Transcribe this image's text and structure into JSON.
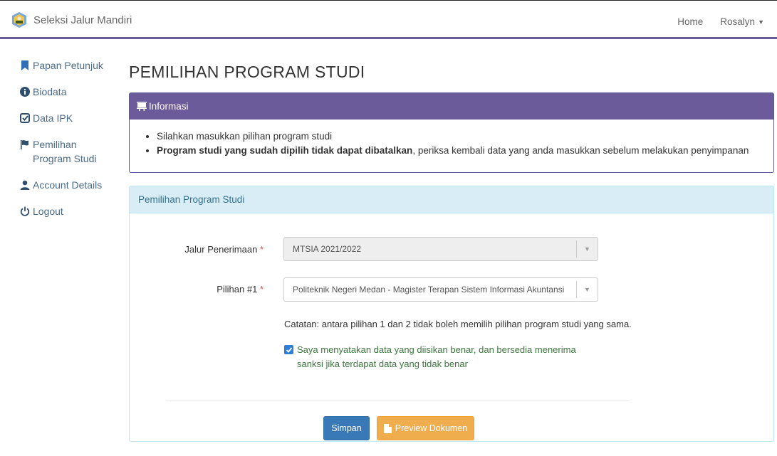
{
  "navbar": {
    "brand": "Seleksi Jalur Mandiri",
    "home": "Home",
    "user": "Rosalyn"
  },
  "sidebar": {
    "items": [
      {
        "label": "Papan Petunjuk",
        "icon": "bookmark-icon"
      },
      {
        "label": "Biodata",
        "icon": "info-circle-icon"
      },
      {
        "label": "Data IPK",
        "icon": "check-square-icon"
      },
      {
        "label": "Pemilihan Program Studi",
        "icon": "flag-icon"
      },
      {
        "label": "Account Details",
        "icon": "user-icon"
      },
      {
        "label": "Logout",
        "icon": "power-icon"
      }
    ]
  },
  "main": {
    "title": "PEMILIHAN PROGRAM STUDI",
    "info": {
      "heading": "Informasi",
      "line1": "Silahkan masukkan pilihan program studi",
      "line2_bold": "Program studi yang sudah dipilih tidak dapat dibatalkan",
      "line2_rest": ", periksa kembali data yang anda masukkan sebelum melakukan penyimpanan"
    },
    "form": {
      "heading": "Pemilihan Program Studi",
      "jalur_label": "Jalur Penerimaan",
      "jalur_value": "MTSIA 2021/2022",
      "pilihan_label": "Pilihan #1",
      "pilihan_value": "Politeknik Negeri Medan - Magister Terapan Sistem Informasi Akuntansi",
      "required_mark": "*",
      "note": "Catatan: antara pilihan 1 dan 2 tidak boleh memilih pilihan program studi yang sama.",
      "agreement_line1": "Saya menyatakan data yang diisikan benar, dan bersedia menerima",
      "agreement_line2": "sanksi jika terdapat data yang tidak benar",
      "agreement_checked": true,
      "save_label": "Simpan",
      "preview_label": "Preview Dokumen"
    }
  },
  "colors": {
    "accent": "#6b5b9a",
    "link": "#4a6b8a",
    "primary": "#3a79b8",
    "warning": "#f0ad4e",
    "success_text": "#3c763d"
  }
}
